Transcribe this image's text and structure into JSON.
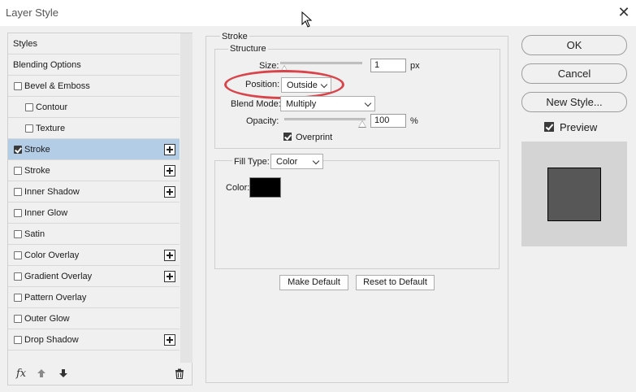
{
  "window": {
    "title": "Layer Style",
    "close_glyph": "✕"
  },
  "left_panel": {
    "items": [
      {
        "label": "Styles",
        "checkbox": false,
        "checked": false,
        "indent": 0,
        "plus": false,
        "selected": false
      },
      {
        "label": "Blending Options",
        "checkbox": false,
        "checked": false,
        "indent": 0,
        "plus": false,
        "selected": false
      },
      {
        "label": "Bevel & Emboss",
        "checkbox": true,
        "checked": false,
        "indent": 0,
        "plus": false,
        "selected": false
      },
      {
        "label": "Contour",
        "checkbox": true,
        "checked": false,
        "indent": 1,
        "plus": false,
        "selected": false
      },
      {
        "label": "Texture",
        "checkbox": true,
        "checked": false,
        "indent": 1,
        "plus": false,
        "selected": false
      },
      {
        "label": "Stroke",
        "checkbox": true,
        "checked": true,
        "indent": 0,
        "plus": true,
        "selected": true
      },
      {
        "label": "Stroke",
        "checkbox": true,
        "checked": false,
        "indent": 0,
        "plus": true,
        "selected": false
      },
      {
        "label": "Inner Shadow",
        "checkbox": true,
        "checked": false,
        "indent": 0,
        "plus": true,
        "selected": false
      },
      {
        "label": "Inner Glow",
        "checkbox": true,
        "checked": false,
        "indent": 0,
        "plus": false,
        "selected": false
      },
      {
        "label": "Satin",
        "checkbox": true,
        "checked": false,
        "indent": 0,
        "plus": false,
        "selected": false
      },
      {
        "label": "Color Overlay",
        "checkbox": true,
        "checked": false,
        "indent": 0,
        "plus": true,
        "selected": false
      },
      {
        "label": "Gradient Overlay",
        "checkbox": true,
        "checked": false,
        "indent": 0,
        "plus": true,
        "selected": false
      },
      {
        "label": "Pattern Overlay",
        "checkbox": true,
        "checked": false,
        "indent": 0,
        "plus": false,
        "selected": false
      },
      {
        "label": "Outer Glow",
        "checkbox": true,
        "checked": false,
        "indent": 0,
        "plus": false,
        "selected": false
      },
      {
        "label": "Drop Shadow",
        "checkbox": true,
        "checked": false,
        "indent": 0,
        "plus": true,
        "selected": false
      }
    ],
    "footer": {
      "fx_label": "fx",
      "icons": [
        "move-up-icon",
        "move-down-icon",
        "trash-icon"
      ]
    }
  },
  "stroke": {
    "group_title": "Stroke",
    "structure_title": "Structure",
    "size_label": "Size:",
    "size_value": "1",
    "size_unit": "px",
    "size_slider_fraction": 0.0,
    "position_label": "Position:",
    "position_value": "Outside",
    "blend_mode_label": "Blend Mode:",
    "blend_mode_value": "Multiply",
    "opacity_label": "Opacity:",
    "opacity_value": "100",
    "opacity_unit": "%",
    "opacity_slider_fraction": 1.0,
    "overprint_label": "Overprint",
    "overprint_checked": true,
    "fill_type_label": "Fill Type:",
    "fill_type_value": "Color",
    "color_label": "Color:",
    "color_value": "#000000",
    "make_default_label": "Make Default",
    "reset_default_label": "Reset to Default"
  },
  "right_panel": {
    "ok_label": "OK",
    "cancel_label": "Cancel",
    "new_style_label": "New Style...",
    "preview_label": "Preview",
    "preview_checked": true
  },
  "colors": {
    "selected_row": "#b4cde6",
    "highlight_oval": "#d9444a",
    "preview_background": "#d4d4d4",
    "preview_square": "#575757"
  }
}
